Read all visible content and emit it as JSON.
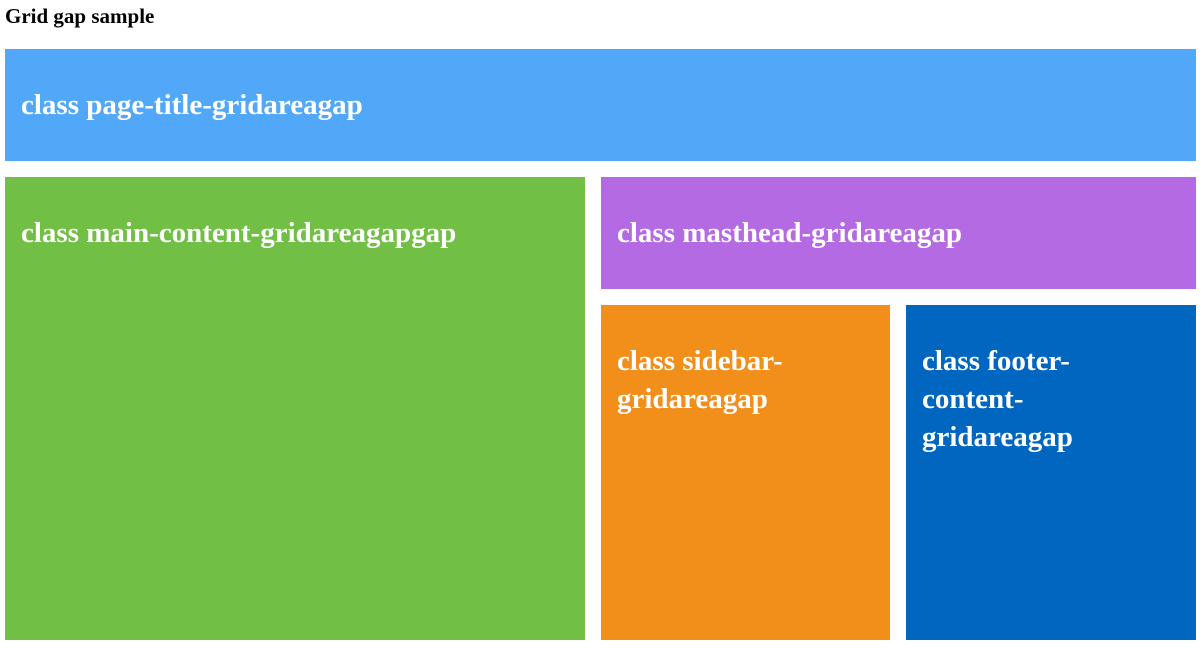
{
  "heading": "Grid gap sample",
  "cells": {
    "page_title": {
      "label": "class page-title-gridareagap",
      "color": "#52A8F8"
    },
    "main_content": {
      "label": "class main-content-gridareagapgap",
      "color": "#71BF44"
    },
    "masthead": {
      "label": "class masthead-gridareagap",
      "color": "#B36AE2"
    },
    "sidebar": {
      "label": "class sidebar-gridareagap",
      "color": "#F28F1A"
    },
    "footer": {
      "label": "class footer-content-gridareagap",
      "color": "#0066C0"
    }
  }
}
